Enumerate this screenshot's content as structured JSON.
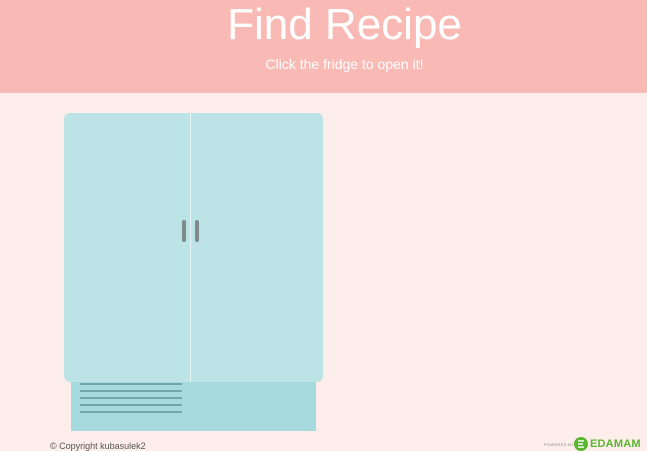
{
  "header": {
    "title": "Find Recipe",
    "subtitle": "Click the fridge to open it!"
  },
  "fridge": {
    "vent_line_count": 5
  },
  "footer": {
    "copyright": "© Copyright kubasulek2",
    "powered_by": "POWERED BY",
    "brand": "EDAMAM"
  },
  "colors": {
    "header_bg": "#f9b9b4",
    "page_bg": "#fdeeec",
    "fridge_door": "#bce3e5",
    "fridge_base": "#a6dade",
    "handle": "#7d8b8c",
    "edamam_green": "#5bb531"
  }
}
